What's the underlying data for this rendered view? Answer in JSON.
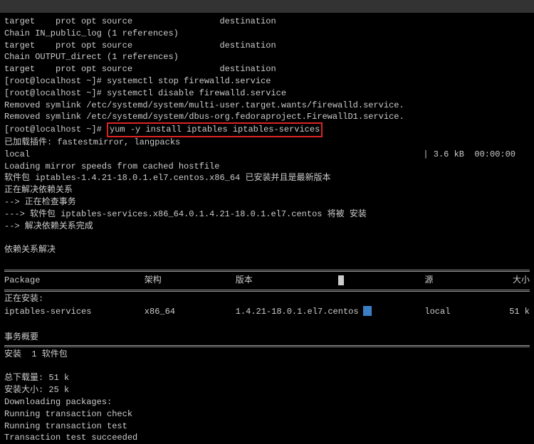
{
  "lines": {
    "l1": "target    prot opt source                 destination",
    "l2": "",
    "l3": "Chain IN_public_log (1 references)",
    "l4": "target    prot opt source                 destination",
    "l5": "",
    "l6": "Chain OUTPUT_direct (1 references)",
    "l7": "target    prot opt source                 destination",
    "l8": "[root@localhost ~]# systemctl stop firewalld.service",
    "l9": "[root@localhost ~]# systemctl disable firewalld.service",
    "l10": "Removed symlink /etc/systemd/system/multi-user.target.wants/firewalld.service.",
    "l11": "Removed symlink /etc/systemd/system/dbus-org.fedoraproject.FirewallD1.service.",
    "l12a": "[root@localhost ~]# ",
    "l12b": "yum -y install iptables iptables-services",
    "l13": "已加载插件: fastestmirror, langpacks",
    "l14": "local",
    "l14r": "| 3.6 kB  00:00:00",
    "l15": "Loading mirror speeds from cached hostfile",
    "l16": "软件包 iptables-1.4.21-18.0.1.el7.centos.x86_64 已安装并且是最新版本",
    "l17": "正在解决依赖关系",
    "l18": "--> 正在检查事务",
    "l19": "---> 软件包 iptables-services.x86_64.0.1.4.21-18.0.1.el7.centos 将被 安装",
    "l20": "--> 解决依赖关系完成",
    "l21": "",
    "l22": "依赖关系解决",
    "l23": ""
  },
  "table": {
    "headers": {
      "pkg": " Package",
      "arch": "架构",
      "ver": "版本",
      "repo": "源",
      "size": "大小"
    },
    "section": "正在安装:",
    "row": {
      "pkg": " iptables-services",
      "arch": "x86_64",
      "ver": "1.4.21-18.0.1.el7.centos",
      "repo": "local",
      "size": "51 k"
    }
  },
  "summary": {
    "s1": "事务概要",
    "s2": "安装  1 软件包",
    "s3": "总下载量: 51 k",
    "s4": "安装大小: 25 k",
    "s5": "Downloading packages:",
    "s6": "Running transaction check",
    "s7": "Running transaction test",
    "s8": "Transaction test succeeded"
  }
}
